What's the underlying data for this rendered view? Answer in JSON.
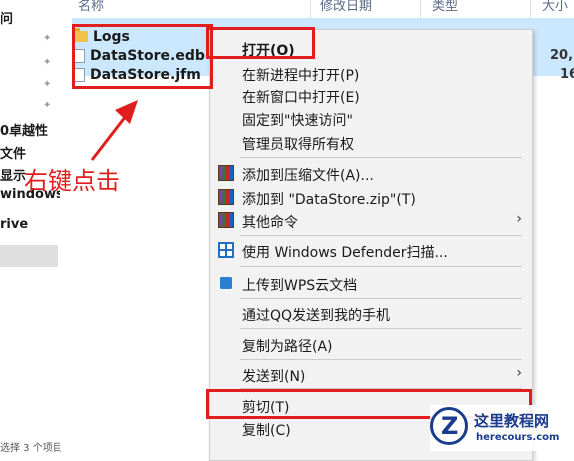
{
  "nav": {
    "items": [
      {
        "label": "问"
      },
      {
        "label": "0卓越性"
      },
      {
        "label": "文件"
      },
      {
        "label": "显示"
      },
      {
        "label": "windows"
      },
      {
        "label": "rive"
      }
    ],
    "status": "选择 3 个项目"
  },
  "columns": [
    "名称",
    "修改日期",
    "类型",
    "大小"
  ],
  "files": [
    {
      "name": "Logs",
      "icon": "folder-icon",
      "size": ""
    },
    {
      "name": "DataStore.edb",
      "icon": "file-icon",
      "size": "20,"
    },
    {
      "name": "DataStore.jfm",
      "icon": "file-icon",
      "size": "16"
    }
  ],
  "menu": {
    "open": "打开(O)",
    "open_new_process": "在新进程中打开(P)",
    "open_new_window": "在新窗口中打开(E)",
    "pin_quick_access": "固定到\"快速访问\"",
    "take_ownership": "管理员取得所有权",
    "add_archive": "添加到压缩文件(A)...",
    "add_zip": "添加到 \"DataStore.zip\"(T)",
    "other_commands": "其他命令",
    "defender_scan": "使用 Windows Defender扫描...",
    "upload_wps": "上传到WPS云文档",
    "send_qq": "通过QQ发送到我的手机",
    "copy_path": "复制为路径(A)",
    "send_to": "发送到(N)",
    "cut": "剪切(T)",
    "copy": "复制(C)",
    "submenu_arrow": "›"
  },
  "annotation": {
    "text": "右键点击",
    "color": "#e01e1e"
  },
  "watermark": {
    "name": "这里教程网",
    "url": "herecours.com",
    "logo_letter": "Z"
  },
  "colors": {
    "selection": "#cce8ff",
    "highlight": "#e01e1e"
  }
}
